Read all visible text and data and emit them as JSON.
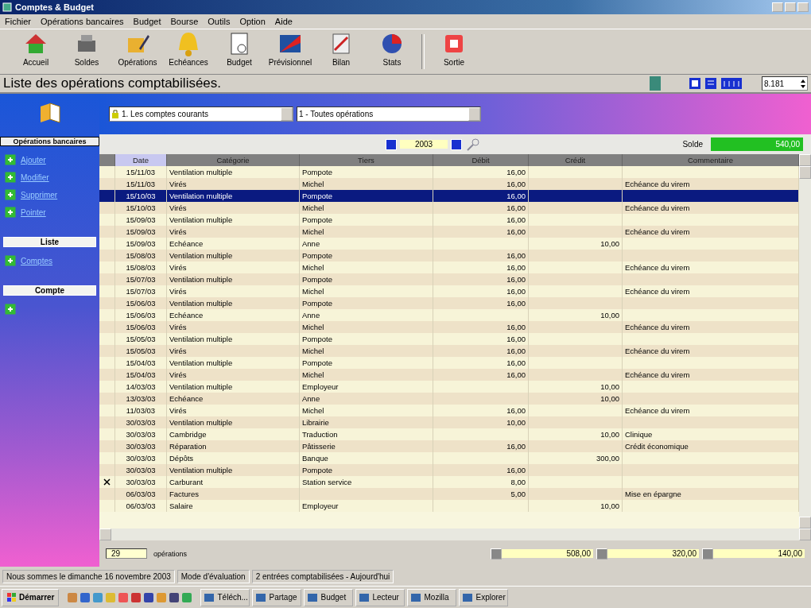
{
  "window": {
    "title": "Comptes & Budget"
  },
  "menu": [
    "Fichier",
    "Opérations bancaires",
    "Budget",
    "Bourse",
    "Outils",
    "Option",
    "Aide"
  ],
  "toolbar": [
    {
      "label": "Accueil"
    },
    {
      "label": "Soldes"
    },
    {
      "label": "Opérations"
    },
    {
      "label": "Echéances"
    },
    {
      "label": "Budget"
    },
    {
      "label": "Prévisionnel"
    },
    {
      "label": "Bilan"
    },
    {
      "label": "Stats"
    },
    {
      "label": "Sortie"
    }
  ],
  "heading": "Liste des opérations comptabilisées.",
  "top_field": "8.181",
  "sidebar": {
    "sections": [
      {
        "title": "Opérations bancaires",
        "items": [
          "Ajouter",
          "Modifier",
          "Supprimer",
          "Pointer"
        ]
      },
      {
        "title": "Liste",
        "items": [
          "Comptes"
        ]
      },
      {
        "title": "Compte"
      }
    ]
  },
  "filters": {
    "account": "1. Les comptes courants",
    "operations": "1 - Toutes opérations"
  },
  "year": "2003",
  "balance": {
    "label": "Solde",
    "value": "540,00"
  },
  "table": {
    "columns": [
      "Date",
      "Catégorie",
      "Tiers",
      "Débit",
      "Crédit",
      "Commentaire"
    ],
    "rows": [
      {
        "date": "15/11/03",
        "category": "Ventilation multiple",
        "tiers": "Pompote",
        "debit": "16,00",
        "selected": false,
        "pointed": false
      },
      {
        "date": "15/11/03",
        "category": "Virés",
        "tiers": "Michel",
        "debit": "16,00",
        "comment": "Echéance du virem",
        "selected": false,
        "pointed": false
      },
      {
        "date": "15/10/03",
        "category": "Ventilation multiple",
        "tiers": "Pompote",
        "debit": "16,00",
        "selected": true,
        "pointed": false
      },
      {
        "date": "15/10/03",
        "category": "Virés",
        "tiers": "Michel",
        "debit": "16,00",
        "comment": "Echéance du virem",
        "selected": false,
        "pointed": false
      },
      {
        "date": "15/09/03",
        "category": "Ventilation multiple",
        "tiers": "Pompote",
        "debit": "16,00",
        "selected": false,
        "pointed": false
      },
      {
        "date": "15/09/03",
        "category": "Virés",
        "tiers": "Michel",
        "debit": "16,00",
        "comment": "Echéance du virem",
        "selected": false,
        "pointed": false
      },
      {
        "date": "15/09/03",
        "category": "Echéance",
        "tiers": "Anne",
        "credit": "10,00",
        "selected": false,
        "pointed": false
      },
      {
        "date": "15/08/03",
        "category": "Ventilation multiple",
        "tiers": "Pompote",
        "debit": "16,00",
        "selected": false,
        "pointed": false
      },
      {
        "date": "15/08/03",
        "category": "Virés",
        "tiers": "Michel",
        "debit": "16,00",
        "comment": "Echéance du virem",
        "selected": false,
        "pointed": false
      },
      {
        "date": "15/07/03",
        "category": "Ventilation multiple",
        "tiers": "Pompote",
        "debit": "16,00",
        "selected": false,
        "pointed": false
      },
      {
        "date": "15/07/03",
        "category": "Virés",
        "tiers": "Michel",
        "debit": "16,00",
        "comment": "Echéance du virem",
        "selected": false,
        "pointed": false
      },
      {
        "date": "15/06/03",
        "category": "Ventilation multiple",
        "tiers": "Pompote",
        "debit": "16,00",
        "selected": false,
        "pointed": false
      },
      {
        "date": "15/06/03",
        "category": "Echéance",
        "tiers": "Anne",
        "credit": "10,00",
        "selected": false,
        "pointed": false
      },
      {
        "date": "15/06/03",
        "category": "Virés",
        "tiers": "Michel",
        "debit": "16,00",
        "comment": "Echéance du virem",
        "selected": false,
        "pointed": false
      },
      {
        "date": "15/05/03",
        "category": "Ventilation multiple",
        "tiers": "Pompote",
        "debit": "16,00",
        "selected": false,
        "pointed": false
      },
      {
        "date": "15/05/03",
        "category": "Virés",
        "tiers": "Michel",
        "debit": "16,00",
        "comment": "Echéance du virem",
        "selected": false,
        "pointed": false
      },
      {
        "date": "15/04/03",
        "category": "Ventilation multiple",
        "tiers": "Pompote",
        "debit": "16,00",
        "selected": false,
        "pointed": false
      },
      {
        "date": "15/04/03",
        "category": "Virés",
        "tiers": "Michel",
        "debit": "16,00",
        "comment": "Echéance du virem",
        "selected": false,
        "pointed": false
      },
      {
        "date": "14/03/03",
        "category": "Ventilation multiple",
        "tiers": "Employeur",
        "credit": "10,00",
        "selected": false,
        "pointed": false
      },
      {
        "date": "13/03/03",
        "category": "Echéance",
        "tiers": "Anne",
        "credit": "10,00",
        "selected": false,
        "pointed": false
      },
      {
        "date": "11/03/03",
        "category": "Virés",
        "tiers": "Michel",
        "debit": "16,00",
        "comment": "Echéance du virem",
        "selected": false,
        "pointed": false
      },
      {
        "date": "30/03/03",
        "category": "Ventilation multiple",
        "tiers": "Librairie",
        "debit": "10,00",
        "selected": false,
        "pointed": false
      },
      {
        "date": "30/03/03",
        "category": "Cambridge",
        "tiers": "Traduction",
        "credit": "10,00",
        "comment": "Clinique",
        "selected": false,
        "pointed": false
      },
      {
        "date": "30/03/03",
        "category": "Réparation",
        "tiers": "Pâtisserie",
        "debit": "16,00",
        "comment": "Crédit économique",
        "selected": false,
        "pointed": false
      },
      {
        "date": "30/03/03",
        "category": "Dépôts",
        "tiers": "Banque",
        "credit": "300,00",
        "selected": false,
        "pointed": false
      },
      {
        "date": "30/03/03",
        "category": "Ventilation multiple",
        "tiers": "Pompote",
        "debit": "16,00",
        "selected": false,
        "pointed": false
      },
      {
        "date": "30/03/03",
        "category": "Carburant",
        "tiers": "Station service",
        "debit": "8,00",
        "selected": false,
        "pointed": true
      },
      {
        "date": "06/03/03",
        "category": "Factures",
        "debit": "5,00",
        "comment": "Mise en épargne",
        "selected": false,
        "pointed": false
      },
      {
        "date": "06/03/03",
        "category": "Salaire",
        "tiers": "Employeur",
        "credit": "10,00",
        "selected": false,
        "pointed": false
      }
    ]
  },
  "footer": {
    "count": "29",
    "count_label": "opérations",
    "totals": [
      "508,00",
      "320,00",
      "140,00"
    ]
  },
  "status_bar": [
    "Nous sommes le dimanche 16 novembre 2003",
    "Mode d'évaluation",
    "2 entrées comptabilisées - Aujourd'hui"
  ],
  "taskbar": {
    "start": "Démarrer",
    "tasks": [
      "Téléch...",
      "Partage",
      "Budget",
      "Lecteur",
      "Mozilla",
      "Explorer"
    ]
  }
}
